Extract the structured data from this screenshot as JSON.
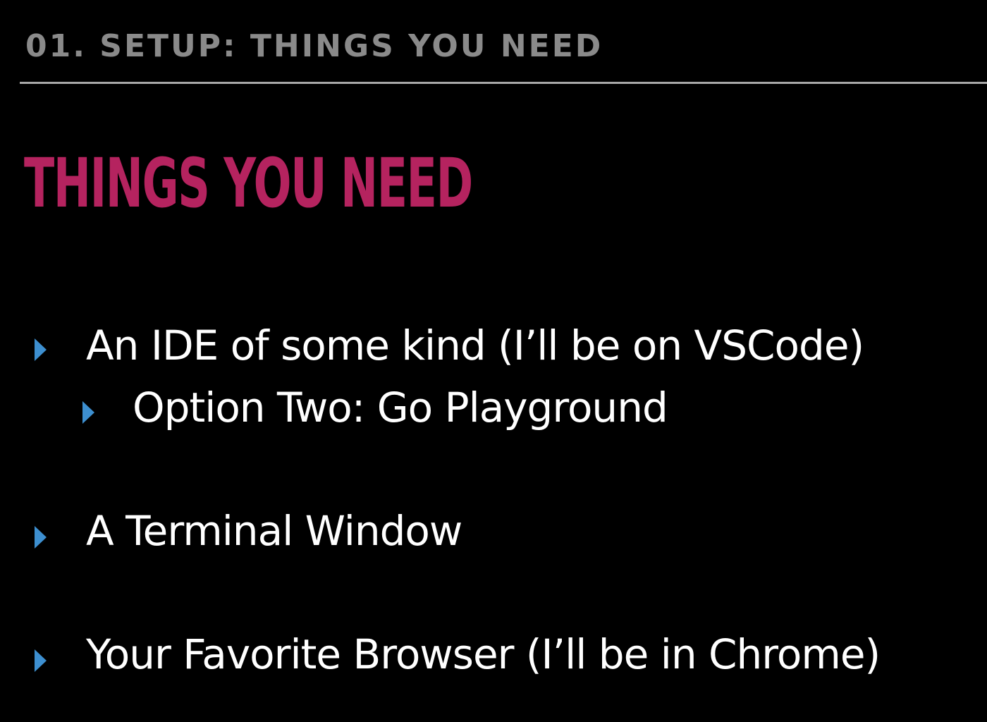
{
  "header": {
    "section_label": "01. SETUP: THINGS YOU NEED"
  },
  "slide": {
    "title": "THINGS YOU NEED",
    "accent_color": "#b5235f",
    "bullet_color": "#3d8fd0",
    "bullets": [
      {
        "text": "An IDE of some kind (I’ll be on VSCode)",
        "level": 1
      },
      {
        "text": "Option Two: Go Playground",
        "level": 2
      },
      {
        "text": "A Terminal Window",
        "level": 1
      },
      {
        "text": "Your Favorite Browser (I’ll be in Chrome)",
        "level": 1
      }
    ]
  }
}
